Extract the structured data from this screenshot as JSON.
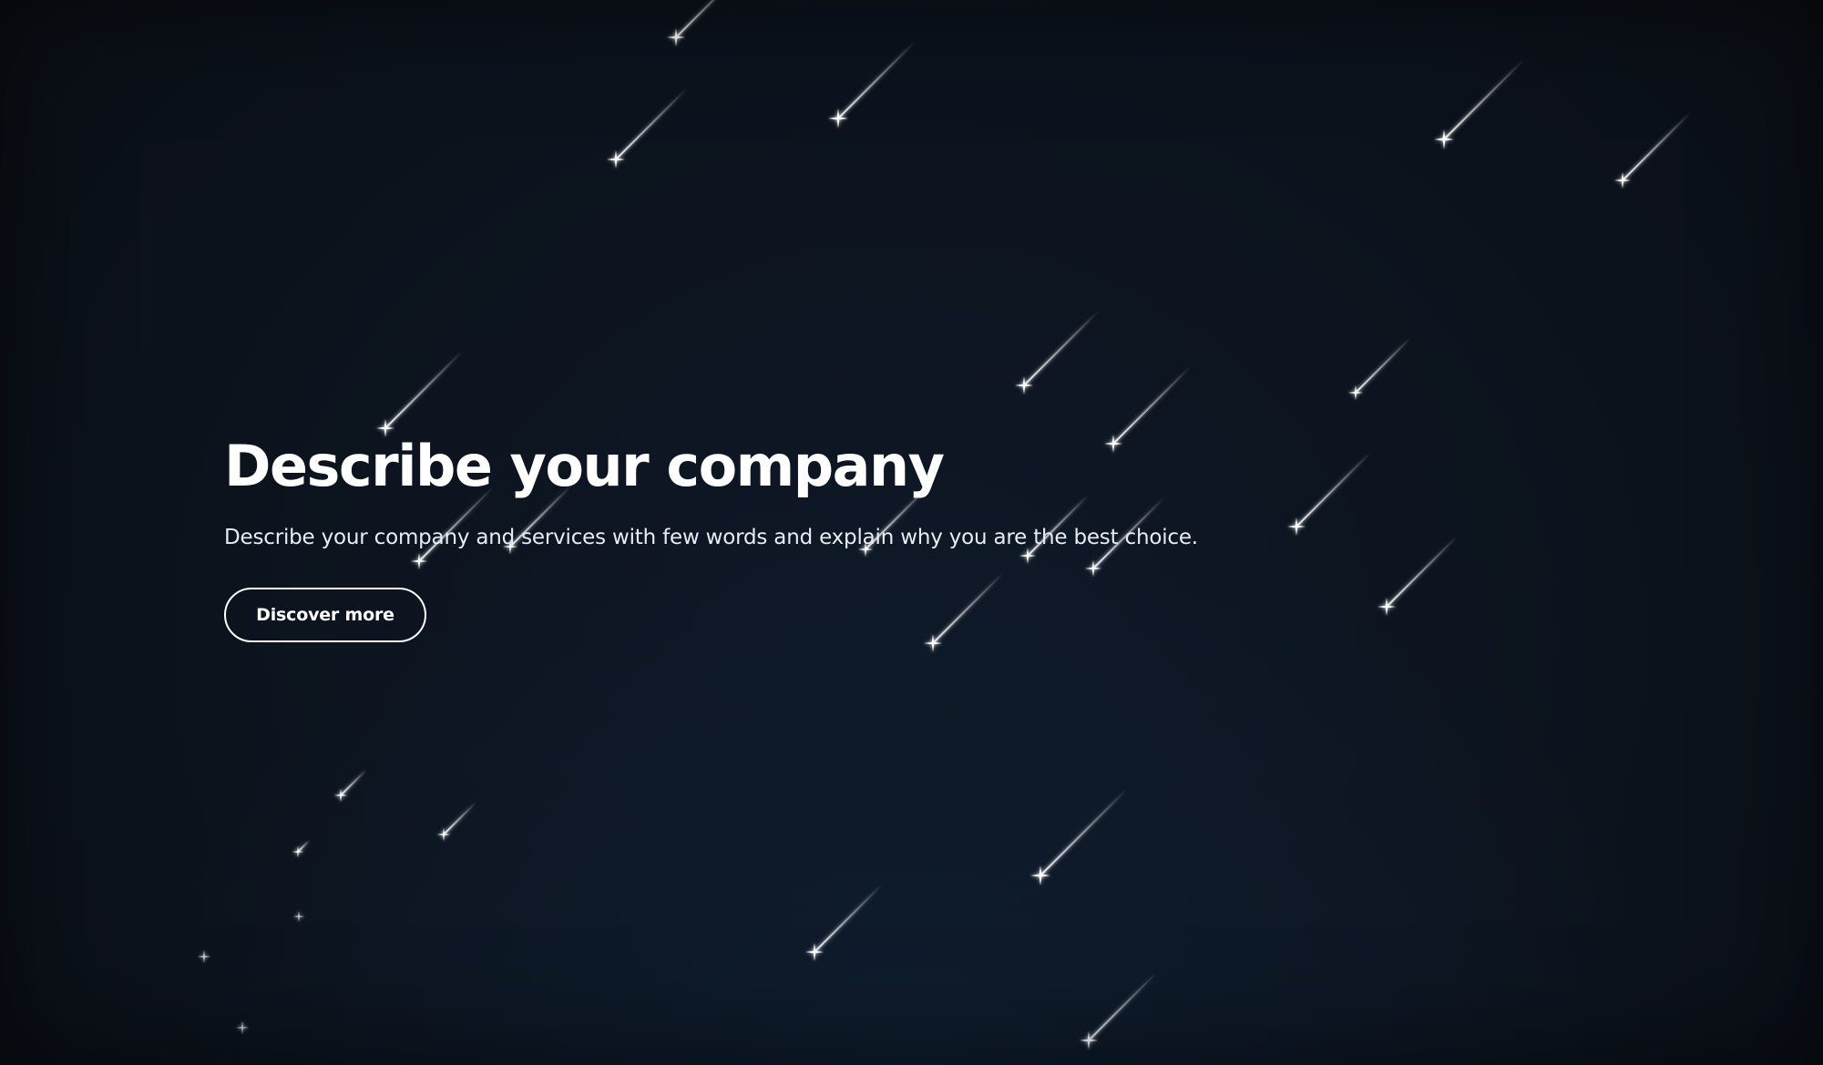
{
  "hero": {
    "headline": "Describe your company",
    "subtext": "Describe your company and services with few words and explain why you are the best choice.",
    "cta_label": "Discover more"
  },
  "theme": {
    "background": "#0c1119",
    "text": "#ffffff",
    "star": "#ffffff"
  },
  "decoration": {
    "icon": "shooting-star-icon"
  }
}
